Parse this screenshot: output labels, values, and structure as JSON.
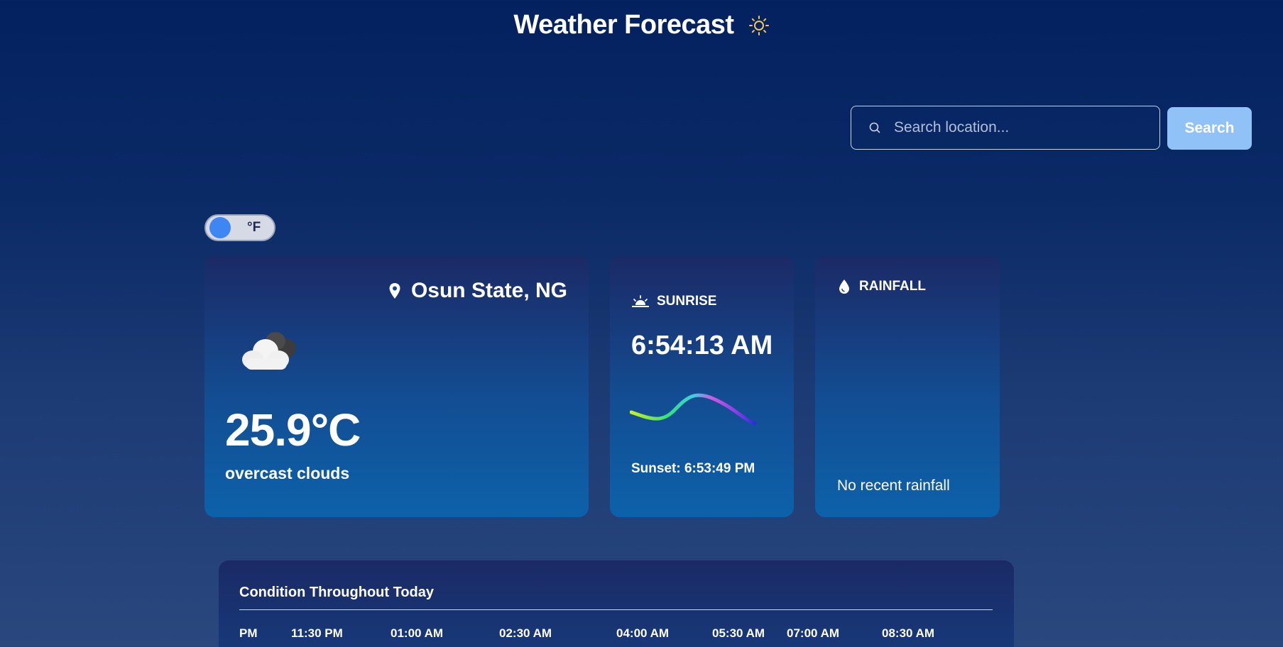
{
  "header": {
    "title": "Weather Forecast",
    "icon": "sun-icon"
  },
  "search": {
    "placeholder": "Search location...",
    "value": "",
    "button_label": "Search"
  },
  "unit_toggle": {
    "label": "°F"
  },
  "current": {
    "location": "Osun State, NG",
    "temperature": "25.9°C",
    "condition": "overcast clouds",
    "icon": "cloud-icon"
  },
  "sun": {
    "title": "SUNRISE",
    "sunrise_time": "6:54:13 AM",
    "sunset_label": "Sunset: 6:53:49 PM"
  },
  "rainfall": {
    "title": "RAINFALL",
    "message": "No recent rainfall"
  },
  "hourly": {
    "title": "Condition Throughout Today",
    "times": [
      "PM",
      "11:30 PM",
      "01:00 AM",
      "02:30 AM",
      "04:00 AM",
      "05:30 AM",
      "07:00 AM",
      "08:30 AM"
    ]
  },
  "colors": {
    "accent": "#3f86f5",
    "search_button": "#90c2f7",
    "card_top": "#1b2a66",
    "card_bottom": "#0c62aa"
  }
}
